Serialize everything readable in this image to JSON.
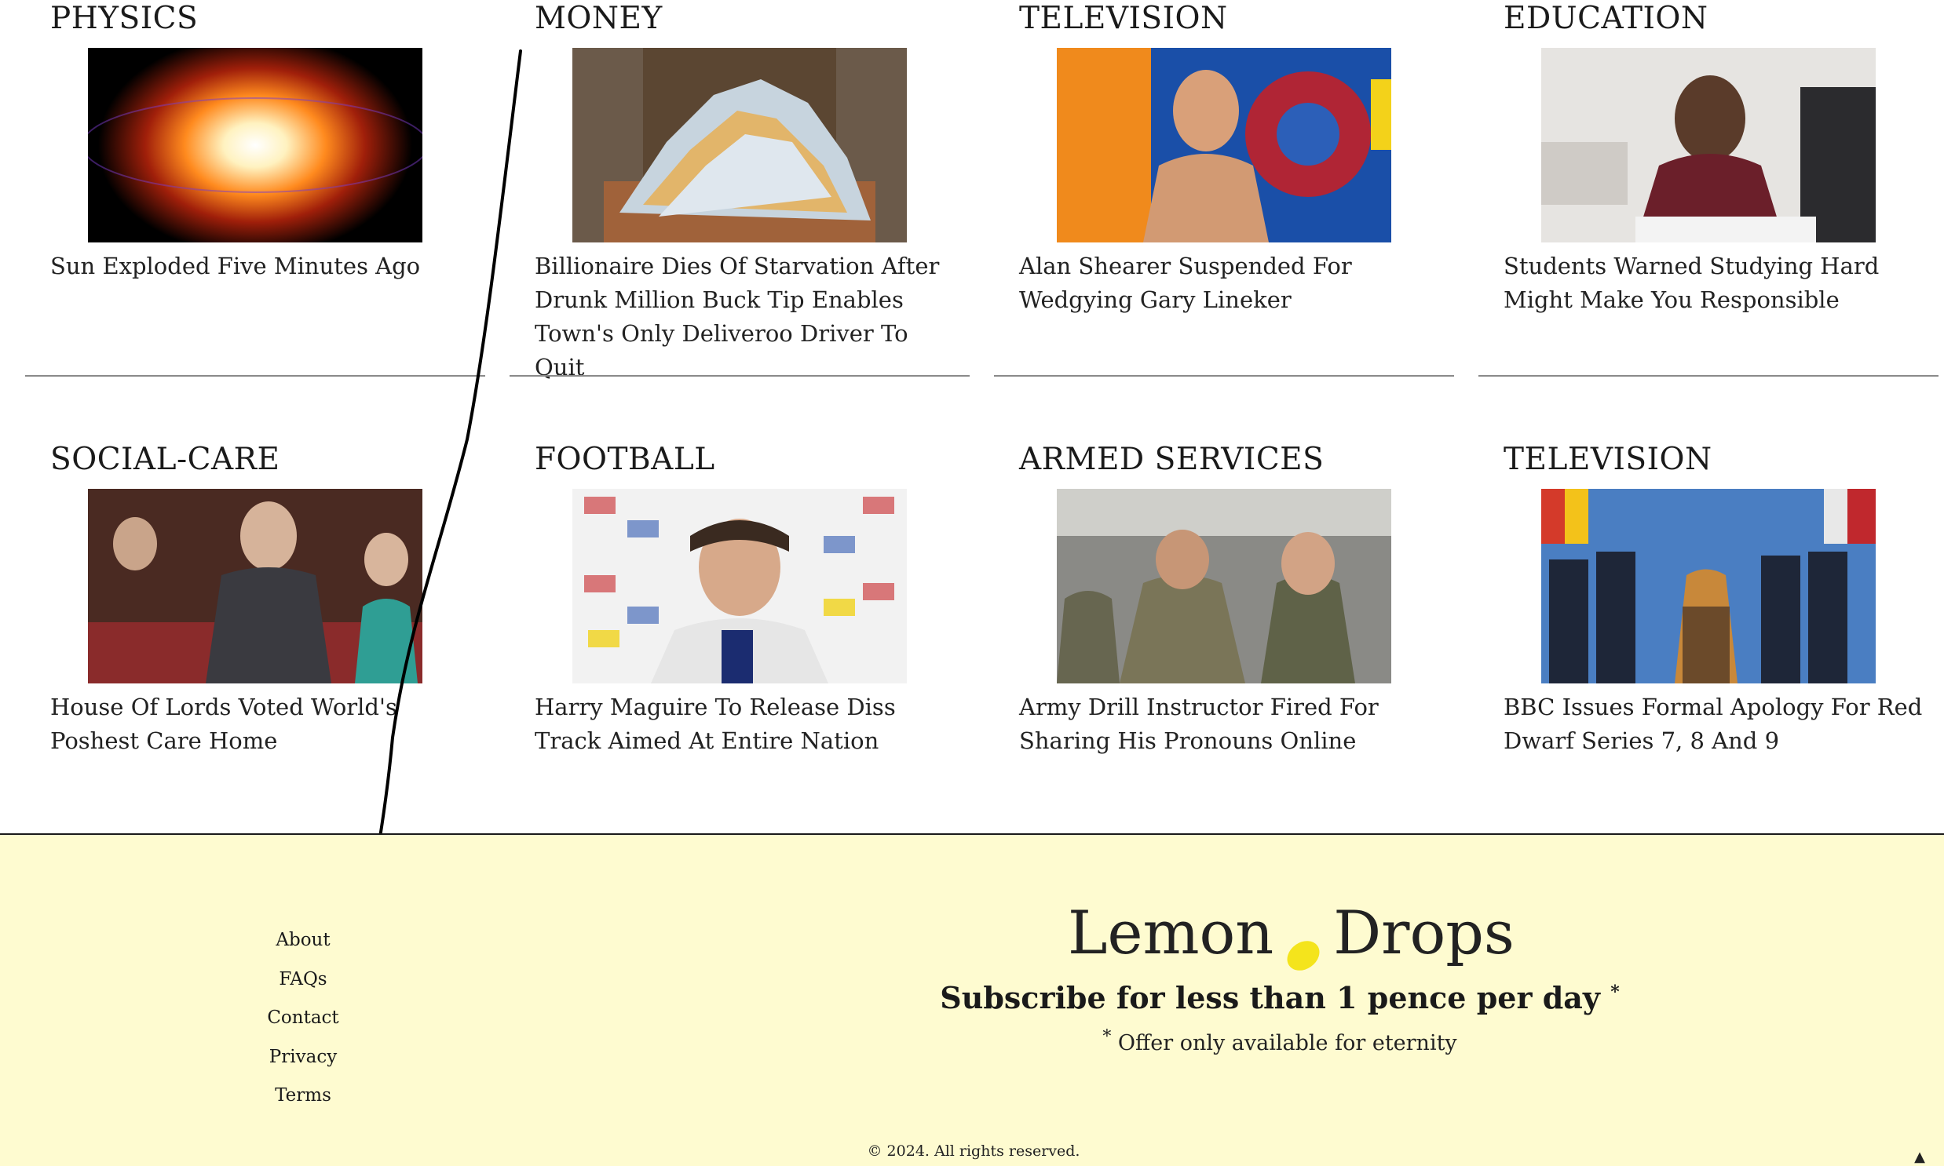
{
  "articles": [
    {
      "category": "PHYSICS",
      "headline": "Sun Exploded Five Minutes Ago"
    },
    {
      "category": "MONEY",
      "headline": "Billionaire Dies Of Starvation After Drunk Million Buck Tip Enables Town's Only Deliveroo Driver To Quit"
    },
    {
      "category": "TELEVISION",
      "headline": "Alan Shearer Suspended For Wedgying Gary Lineker"
    },
    {
      "category": "EDUCATION",
      "headline": "Students Warned Studying Hard Might Make You Responsible"
    },
    {
      "category": "SOCIAL-CARE",
      "headline": "House Of Lords Voted World's Poshest Care Home"
    },
    {
      "category": "FOOTBALL",
      "headline": "Harry Maguire To Release Diss Track Aimed At Entire Nation"
    },
    {
      "category": "ARMED SERVICES",
      "headline": "Army Drill Instructor Fired For Sharing His Pronouns Online"
    },
    {
      "category": "TELEVISION",
      "headline": "BBC Issues Formal Apology For Red Dwarf Series 7, 8 And 9"
    }
  ],
  "footer": {
    "links": [
      "About",
      "FAQs",
      "Contact",
      "Privacy",
      "Terms"
    ],
    "brand_left": "Lemon",
    "brand_right": "Drops",
    "subscribe": "Subscribe for less than 1 pence per day",
    "subscribe_mark": "*",
    "offer_mark": "*",
    "offer": "Offer only available for eternity",
    "copyright": "© 2024. All rights reserved.",
    "scroll_top_icon": "arrow-up-icon"
  },
  "colors": {
    "footer_bg": "#fefbd0",
    "lemon": "#f4e41c",
    "text": "#1f1f1f"
  }
}
